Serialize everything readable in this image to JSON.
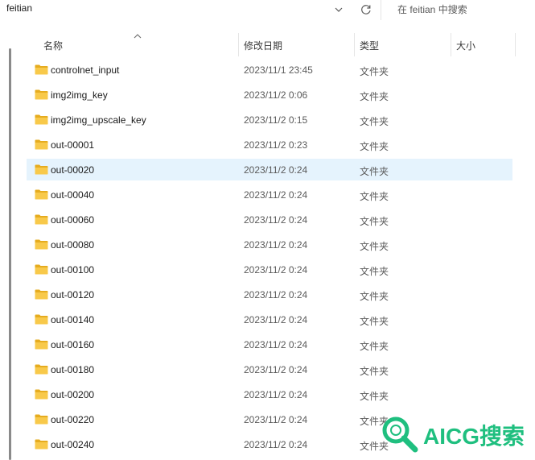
{
  "address_bar": {
    "path": "feitian"
  },
  "search": {
    "placeholder": "在 feitian 中搜索"
  },
  "columns": {
    "name": "名称",
    "date": "修改日期",
    "type": "类型",
    "size": "大小"
  },
  "files": [
    {
      "name": "controlnet_input",
      "date": "2023/11/1 23:45",
      "type": "文件夹",
      "selected": false
    },
    {
      "name": "img2img_key",
      "date": "2023/11/2 0:06",
      "type": "文件夹",
      "selected": false
    },
    {
      "name": "img2img_upscale_key",
      "date": "2023/11/2 0:15",
      "type": "文件夹",
      "selected": false
    },
    {
      "name": "out-00001",
      "date": "2023/11/2 0:23",
      "type": "文件夹",
      "selected": false
    },
    {
      "name": "out-00020",
      "date": "2023/11/2 0:24",
      "type": "文件夹",
      "selected": true
    },
    {
      "name": "out-00040",
      "date": "2023/11/2 0:24",
      "type": "文件夹",
      "selected": false
    },
    {
      "name": "out-00060",
      "date": "2023/11/2 0:24",
      "type": "文件夹",
      "selected": false
    },
    {
      "name": "out-00080",
      "date": "2023/11/2 0:24",
      "type": "文件夹",
      "selected": false
    },
    {
      "name": "out-00100",
      "date": "2023/11/2 0:24",
      "type": "文件夹",
      "selected": false
    },
    {
      "name": "out-00120",
      "date": "2023/11/2 0:24",
      "type": "文件夹",
      "selected": false
    },
    {
      "name": "out-00140",
      "date": "2023/11/2 0:24",
      "type": "文件夹",
      "selected": false
    },
    {
      "name": "out-00160",
      "date": "2023/11/2 0:24",
      "type": "文件夹",
      "selected": false
    },
    {
      "name": "out-00180",
      "date": "2023/11/2 0:24",
      "type": "文件夹",
      "selected": false
    },
    {
      "name": "out-00200",
      "date": "2023/11/2 0:24",
      "type": "文件夹",
      "selected": false
    },
    {
      "name": "out-00220",
      "date": "2023/11/2 0:24",
      "type": "文件夹",
      "selected": false
    },
    {
      "name": "out-00240",
      "date": "2023/11/2 0:24",
      "type": "文件夹",
      "selected": false
    }
  ],
  "watermark": {
    "text": "AICG搜索"
  },
  "colors": {
    "folder": "#f8c94a",
    "folder_dark": "#e6ac1f",
    "selected_row": "#e5f3fd",
    "watermark": "#1fbf7f"
  },
  "icons": {
    "dropdown": "chevron-down-icon",
    "refresh": "refresh-icon",
    "folder": "folder-icon",
    "sort": "sort-up-icon",
    "watermark": "magnifier-logo-icon"
  }
}
